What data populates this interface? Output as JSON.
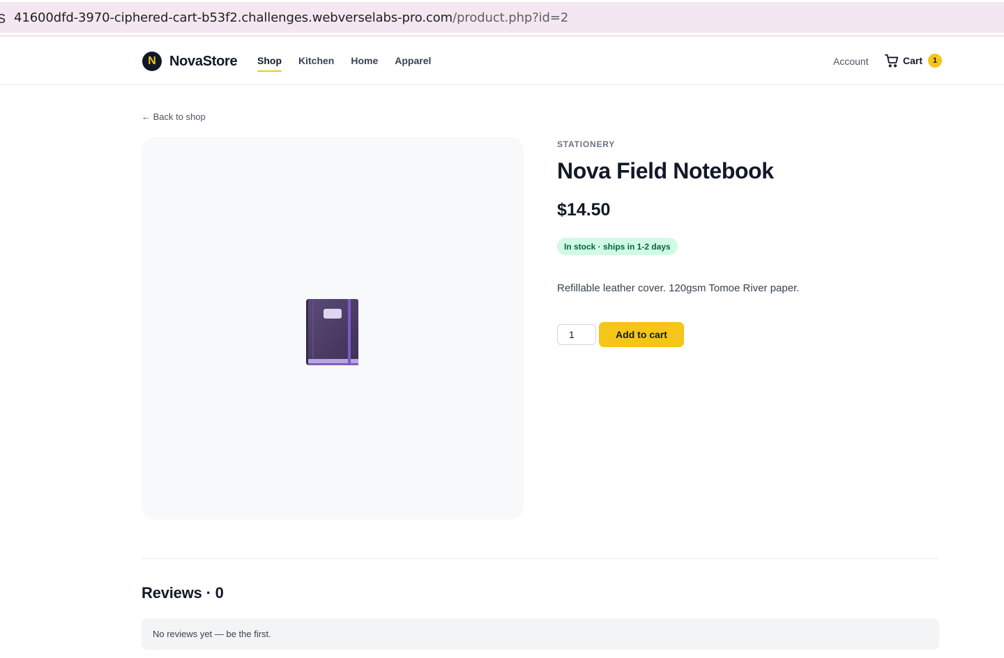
{
  "browser": {
    "url_host": "41600dfd-3970-ciphered-cart-b53f2.challenges.webverselabs-pro.com",
    "url_path": "/product.php?id=2",
    "edge_glyph": "S"
  },
  "header": {
    "logo_mark": "N",
    "brand": "NovaStore",
    "nav": [
      "Shop",
      "Kitchen",
      "Home",
      "Apparel"
    ],
    "active_nav": "Shop",
    "account_label": "Account",
    "cart_label": "Cart",
    "cart_count": "1"
  },
  "back_link": "← Back to shop",
  "product": {
    "image_icon": "notebook-emoji-icon",
    "category": "STATIONERY",
    "name": "Nova Field Notebook",
    "price": "$14.50",
    "stock": "In stock · ships in 1-2 days",
    "description": "Refillable leather cover. 120gsm Tomoe River paper.",
    "quantity": "1",
    "add_to_cart_label": "Add to cart"
  },
  "reviews": {
    "title": "Reviews · 0",
    "empty_message": "No reviews yet — be the first."
  },
  "colors": {
    "accent": "#f5c518",
    "url_bar": "#f3e8f1",
    "stock_bg": "#d1fae5",
    "stock_text": "#065f46",
    "image_bg": "#f8f9fa"
  }
}
